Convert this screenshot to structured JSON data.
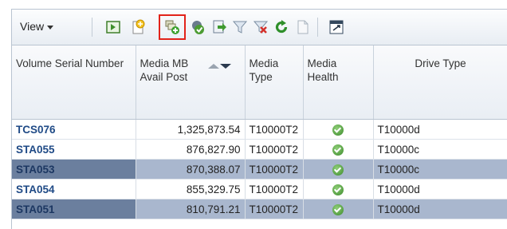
{
  "toolbar": {
    "view_label": "View",
    "icons": [
      "detach-icon",
      "new-icon",
      "add-to-group-icon",
      "validate-icon",
      "export-icon",
      "filter-icon",
      "clear-filter-icon",
      "refresh-icon",
      "properties-icon",
      "freeze-icon"
    ]
  },
  "table": {
    "columns": [
      {
        "label": "Volume Serial Number"
      },
      {
        "label": "Media MB Avail Post"
      },
      {
        "label": "Media Type"
      },
      {
        "label": "Media Health"
      },
      {
        "label": "Drive Type"
      }
    ],
    "rows": [
      {
        "serial": "TCS076",
        "mb": "1,325,873.54",
        "type": "T10000T2",
        "health": "ok",
        "drive": "T10000d",
        "selected": false
      },
      {
        "serial": "STA055",
        "mb": "876,827.90",
        "type": "T10000T2",
        "health": "ok",
        "drive": "T10000c",
        "selected": false
      },
      {
        "serial": "STA053",
        "mb": "870,388.07",
        "type": "T10000T2",
        "health": "ok",
        "drive": "T10000c",
        "selected": true
      },
      {
        "serial": "STA054",
        "mb": "855,329.75",
        "type": "T10000T2",
        "health": "ok",
        "drive": "T10000d",
        "selected": false
      },
      {
        "serial": "STA051",
        "mb": "810,791.21",
        "type": "T10000T2",
        "health": "ok",
        "drive": "T10000d",
        "selected": true
      }
    ]
  },
  "colors": {
    "highlight": "#e2231a",
    "selected_row": "#a9b7ce",
    "serial_text": "#1f4a86",
    "health_ok": "#3d8a2c"
  }
}
